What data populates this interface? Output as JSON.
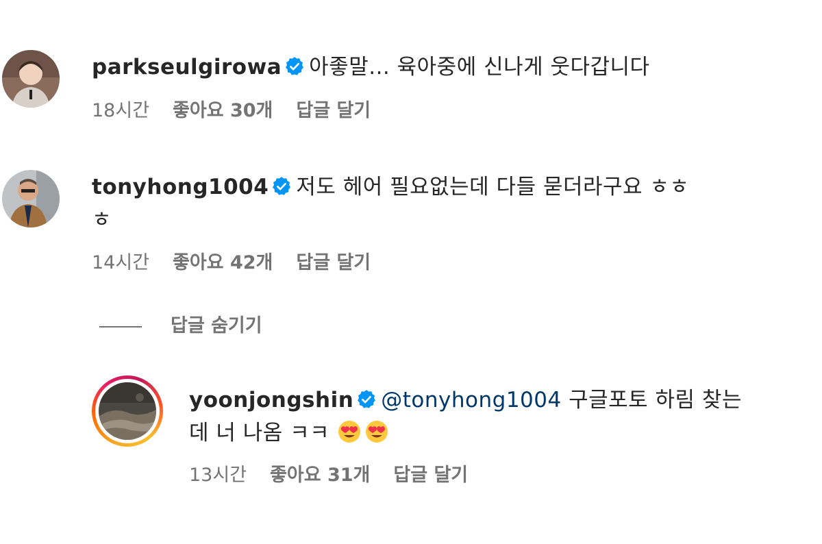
{
  "comments": [
    {
      "username": "parkseulgirowa",
      "verified": true,
      "text": "아좋말... 육아중에 신나게 웃다갑니다",
      "time": "18시간",
      "likes": "좋아요 30개",
      "reply": "답글 달기"
    },
    {
      "username": "tonyhong1004",
      "verified": true,
      "text_line1": "저도 헤어 필요없는데 다들 묻더라구요 ㅎㅎ",
      "text_line2": "ㅎ",
      "time": "14시간",
      "likes": "좋아요 42개",
      "reply": "답글 달기"
    }
  ],
  "hide_replies_label": "답글 숨기기",
  "reply": {
    "username": "yoonjongshin",
    "verified": true,
    "mention": "@tonyhong1004",
    "text_line1": "구글포토 하림 찾는",
    "text_line2": "데 너 나옴 ㅋㅋ",
    "emoji": [
      "heart-eyes-emoji",
      "heart-eyes-emoji"
    ],
    "time": "13시간",
    "likes": "좋아요 31개",
    "reply": "답글 달기"
  },
  "colors": {
    "verified_blue": "#0095f6",
    "mention": "#00376b",
    "meta_gray": "#737373"
  }
}
